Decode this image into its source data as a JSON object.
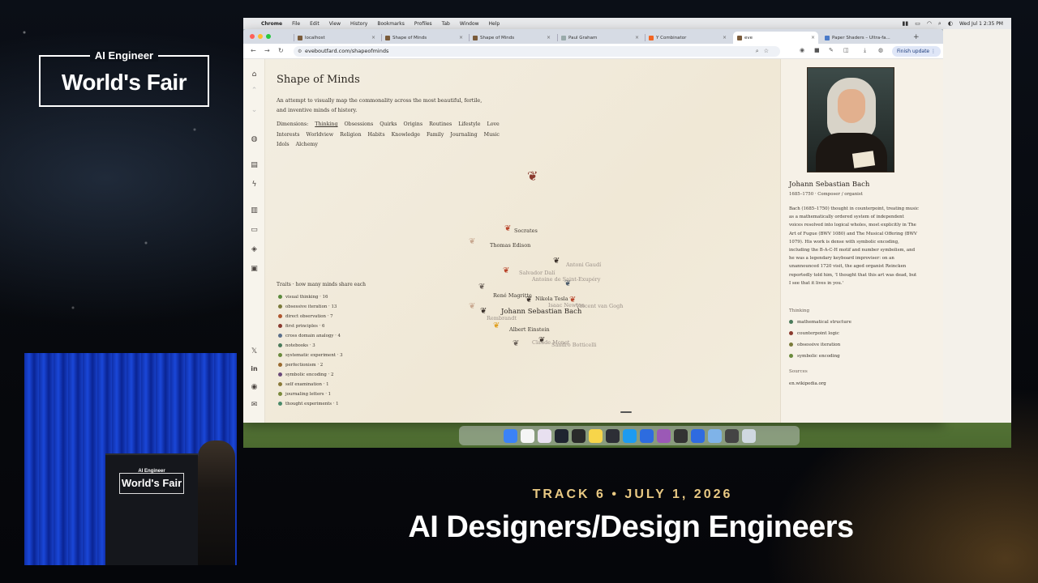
{
  "event": {
    "brand_top": "AI Engineer",
    "brand_name": "World's Fair",
    "podium_top": "AI Engineer",
    "podium_name": "World's Fair",
    "track": "TRACK 6 • JULY 1, 2026",
    "talk_title": "AI Designers/Design Engineers"
  },
  "menubar": {
    "app": "Chrome",
    "items": [
      "File",
      "Edit",
      "View",
      "History",
      "Bookmarks",
      "Profiles",
      "Tab",
      "Window",
      "Help"
    ],
    "clock": "Wed Jul 1  2:35 PM"
  },
  "tabs": [
    {
      "title": "localhost"
    },
    {
      "title": "Shape of Minds"
    },
    {
      "title": "Shape of Minds"
    },
    {
      "title": "Paul Graham"
    },
    {
      "title": "Y Combinator"
    },
    {
      "title": "eve"
    },
    {
      "title": "Paper Shaders – Ultra-fa..."
    }
  ],
  "toolbar": {
    "url": "eveboutfard.com/shapeofminds",
    "finish_update": "Finish update"
  },
  "page": {
    "title": "Shape of Minds",
    "subtitle": "An attempt to visually map the commonality across the most beautiful, fertile, and inventive minds of history.",
    "dimensions_label": "Dimensions:",
    "dimensions": [
      "Thinking",
      "Obsessions",
      "Quirks",
      "Origins",
      "Routines",
      "Lifestyle",
      "Love",
      "Interests",
      "Worldview",
      "Religion",
      "Habits",
      "Knowledge",
      "Family",
      "Journaling",
      "Music",
      "Idols",
      "Alchemy"
    ],
    "selected_dimension": "Thinking",
    "traits_header": "Traits · how many minds share each",
    "traits": [
      {
        "label": "visual thinking · 16",
        "color": "#5a8a3c"
      },
      {
        "label": "obsessive iteration · 13",
        "color": "#7a7a3a"
      },
      {
        "label": "direct observation · 7",
        "color": "#b0572e"
      },
      {
        "label": "first principles · 6",
        "color": "#8a3a2e"
      },
      {
        "label": "cross domain analogy · 4",
        "color": "#5a6e8a"
      },
      {
        "label": "notebooks · 3",
        "color": "#4a7a5a"
      },
      {
        "label": "systematic experiment · 3",
        "color": "#6a8a3c"
      },
      {
        "label": "perfectionism · 2",
        "color": "#9a6a2e"
      },
      {
        "label": "symbolic encoding · 2",
        "color": "#6a4a7a"
      },
      {
        "label": "self examination · 1",
        "color": "#8a7a3a"
      },
      {
        "label": "journaling letters · 1",
        "color": "#7a8a3c"
      },
      {
        "label": "thought experiments · 1",
        "color": "#4a8a6a"
      }
    ],
    "minds": {
      "socrates": "Socrates",
      "thomas_edison": "Thomas Edison",
      "antoni_gaudi": "Antoni Gaudí",
      "salvador_dali": "Salvador Dalí",
      "saint_exupery": "Antoine de Saint-Exupéry",
      "rene_magritte": "René Magritte",
      "nikola_tesla": "Nikola Tesla",
      "isaac_newton": "Isaac Newton",
      "van_gogh": "Vincent van Gogh",
      "rembrandt": "Rembrandt",
      "johann_bach": "Johann Sebastian Bach",
      "albert_einstein": "Albert Einstein",
      "claude_monet": "Claude Monet",
      "botticelli": "Sandro Botticelli"
    }
  },
  "sidebar": {
    "name": "Johann Sebastian Bach",
    "meta": "1685–1750 · Composer / organist",
    "bio": "Bach (1685–1750) thought in counterpoint, treating music as a mathematically ordered system of independent voices resolved into logical wholes, most explicitly in The Art of Fugue (BWV 1080) and The Musical Offering (BWV 1079). His work is dense with symbolic encoding, including the B-A-C-H motif and number symbolism, and he was a legendary keyboard improviser: on an unannounced 1720 visit, the aged organist Reincken reportedly told him, 'I thought that this art was dead, but I see that it lives in you.'",
    "thinking_header": "Thinking",
    "traits": [
      {
        "label": "mathematical structure",
        "color": "#4a7a5a"
      },
      {
        "label": "counterpoint logic",
        "color": "#8a3a2e"
      },
      {
        "label": "obsessive iteration",
        "color": "#7a7a3a"
      },
      {
        "label": "symbolic encoding",
        "color": "#6a8a3c"
      }
    ],
    "sources_header": "Sources",
    "source": "en.wikipedia.org"
  },
  "colors": {
    "page_bg": "#f3eee2",
    "accent_gold": "#e9c983",
    "butterfly_red": "#b8442a",
    "butterfly_dark": "#3a302a"
  }
}
